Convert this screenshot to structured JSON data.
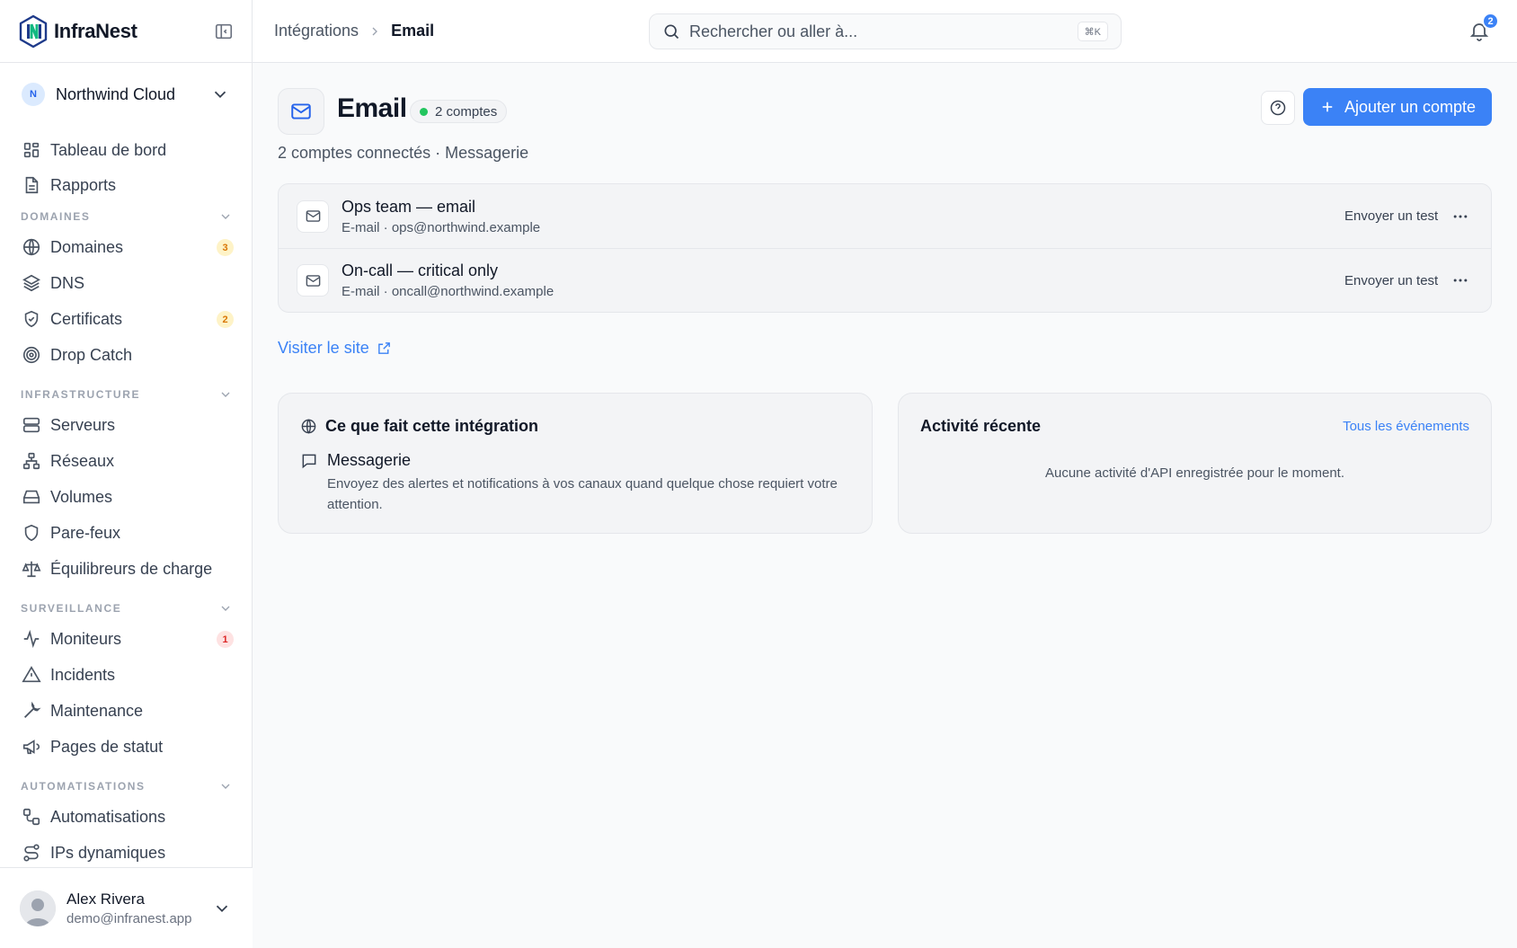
{
  "app": {
    "name": "InfraNest"
  },
  "org": {
    "initial": "N",
    "name": "Northwind Cloud"
  },
  "nav": {
    "top": [
      {
        "label": "Tableau de bord",
        "icon": "dashboard-icon"
      },
      {
        "label": "Rapports",
        "icon": "report-icon"
      }
    ],
    "sections": [
      {
        "title": "DOMAINES",
        "items": [
          {
            "label": "Domaines",
            "icon": "globe-icon",
            "badge": "3"
          },
          {
            "label": "DNS",
            "icon": "layers-icon"
          },
          {
            "label": "Certificats",
            "icon": "shield-check-icon",
            "badge": "2"
          },
          {
            "label": "Drop Catch",
            "icon": "target-icon"
          }
        ]
      },
      {
        "title": "INFRASTRUCTURE",
        "items": [
          {
            "label": "Serveurs",
            "icon": "server-icon"
          },
          {
            "label": "Réseaux",
            "icon": "network-icon"
          },
          {
            "label": "Volumes",
            "icon": "hard-drive-icon"
          },
          {
            "label": "Pare-feux",
            "icon": "shield-icon"
          },
          {
            "label": "Équilibreurs de charge",
            "icon": "scale-icon"
          }
        ]
      },
      {
        "title": "SURVEILLANCE",
        "items": [
          {
            "label": "Moniteurs",
            "icon": "activity-icon",
            "badge": "1"
          },
          {
            "label": "Incidents",
            "icon": "alert-triangle-icon"
          },
          {
            "label": "Maintenance",
            "icon": "wrench-icon"
          },
          {
            "label": "Pages de statut",
            "icon": "megaphone-icon"
          }
        ]
      },
      {
        "title": "AUTOMATISATIONS",
        "items": [
          {
            "label": "Automatisations",
            "icon": "workflow-icon"
          },
          {
            "label": "IPs dynamiques",
            "icon": "route-icon"
          }
        ]
      }
    ]
  },
  "user": {
    "name": "Alex Rivera",
    "email": "demo@infranest.app"
  },
  "topbar": {
    "breadcrumb": [
      "Intégrations",
      "Email"
    ],
    "search_placeholder": "Rechercher ou aller à...",
    "search_shortcut": "⌘K",
    "notifications_count": "2"
  },
  "integration": {
    "title": "Email",
    "status_pill": "2 comptes",
    "subtitle": "2 comptes connectés · Messagerie",
    "add_button": "Ajouter un compte",
    "accounts": [
      {
        "name": "Ops team — email",
        "detail": "E-mail · ops@northwind.example",
        "action": "Envoyer un test"
      },
      {
        "name": "On-call — critical only",
        "detail": "E-mail · oncall@northwind.example",
        "action": "Envoyer un test"
      }
    ],
    "visit_link": "Visiter le site"
  },
  "about_card": {
    "title": "Ce que fait cette intégration",
    "feature_title": "Messagerie",
    "feature_desc": "Envoyez des alertes et notifications à vos canaux quand quelque chose requiert votre attention."
  },
  "activity_card": {
    "title": "Activité récente",
    "link": "Tous les événements",
    "empty": "Aucune activité d'API enregistrée pour le moment."
  },
  "colors": {
    "accent": "#3b82f6",
    "status_ok": "#22c55e",
    "badge_amber": "#d97706",
    "badge_red": "#dc2626"
  }
}
